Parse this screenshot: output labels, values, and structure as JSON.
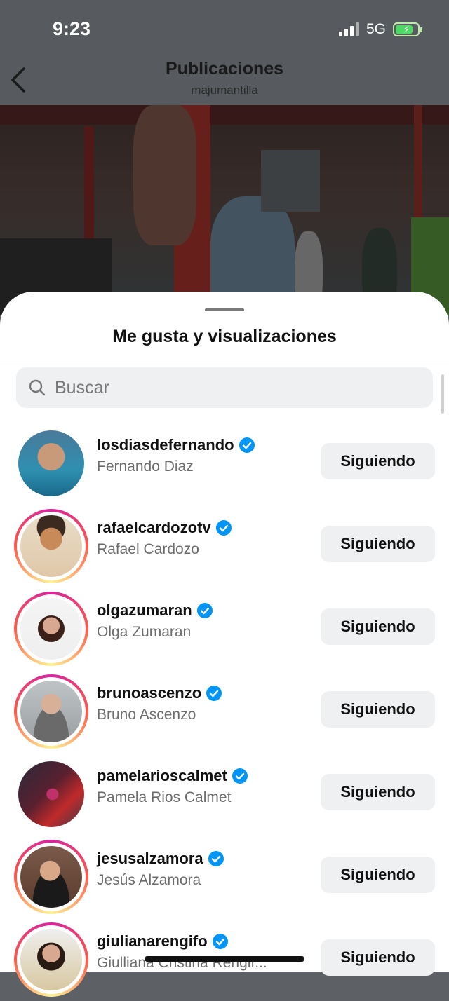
{
  "status": {
    "time": "9:23",
    "network": "5G"
  },
  "header": {
    "title": "Publicaciones",
    "subtitle": "majumantilla"
  },
  "sheet": {
    "title": "Me gusta y visualizaciones"
  },
  "search": {
    "placeholder": "Buscar"
  },
  "users": [
    {
      "username": "losdiasdefernando",
      "name": "Fernando Diaz",
      "button": "Siguiendo",
      "story": false
    },
    {
      "username": "rafaelcardozotv",
      "name": "Rafael Cardozo",
      "button": "Siguiendo",
      "story": true
    },
    {
      "username": "olgazumaran",
      "name": "Olga Zumaran",
      "button": "Siguiendo",
      "story": true
    },
    {
      "username": "brunoascenzo",
      "name": "Bruno Ascenzo",
      "button": "Siguiendo",
      "story": true
    },
    {
      "username": "pamelarioscalmet",
      "name": "Pamela Rios Calmet",
      "button": "Siguiendo",
      "story": false
    },
    {
      "username": "jesusalzamora",
      "name": "Jesús Alzamora",
      "button": "Siguiendo",
      "story": true
    },
    {
      "username": "giulianarengifo",
      "name": "Giulliana Cristina Rengif...",
      "button": "Siguiendo",
      "story": true
    }
  ],
  "colors": {
    "verified": "#0095f6",
    "button_bg": "#eff0f2",
    "battery": "#4cd964"
  }
}
